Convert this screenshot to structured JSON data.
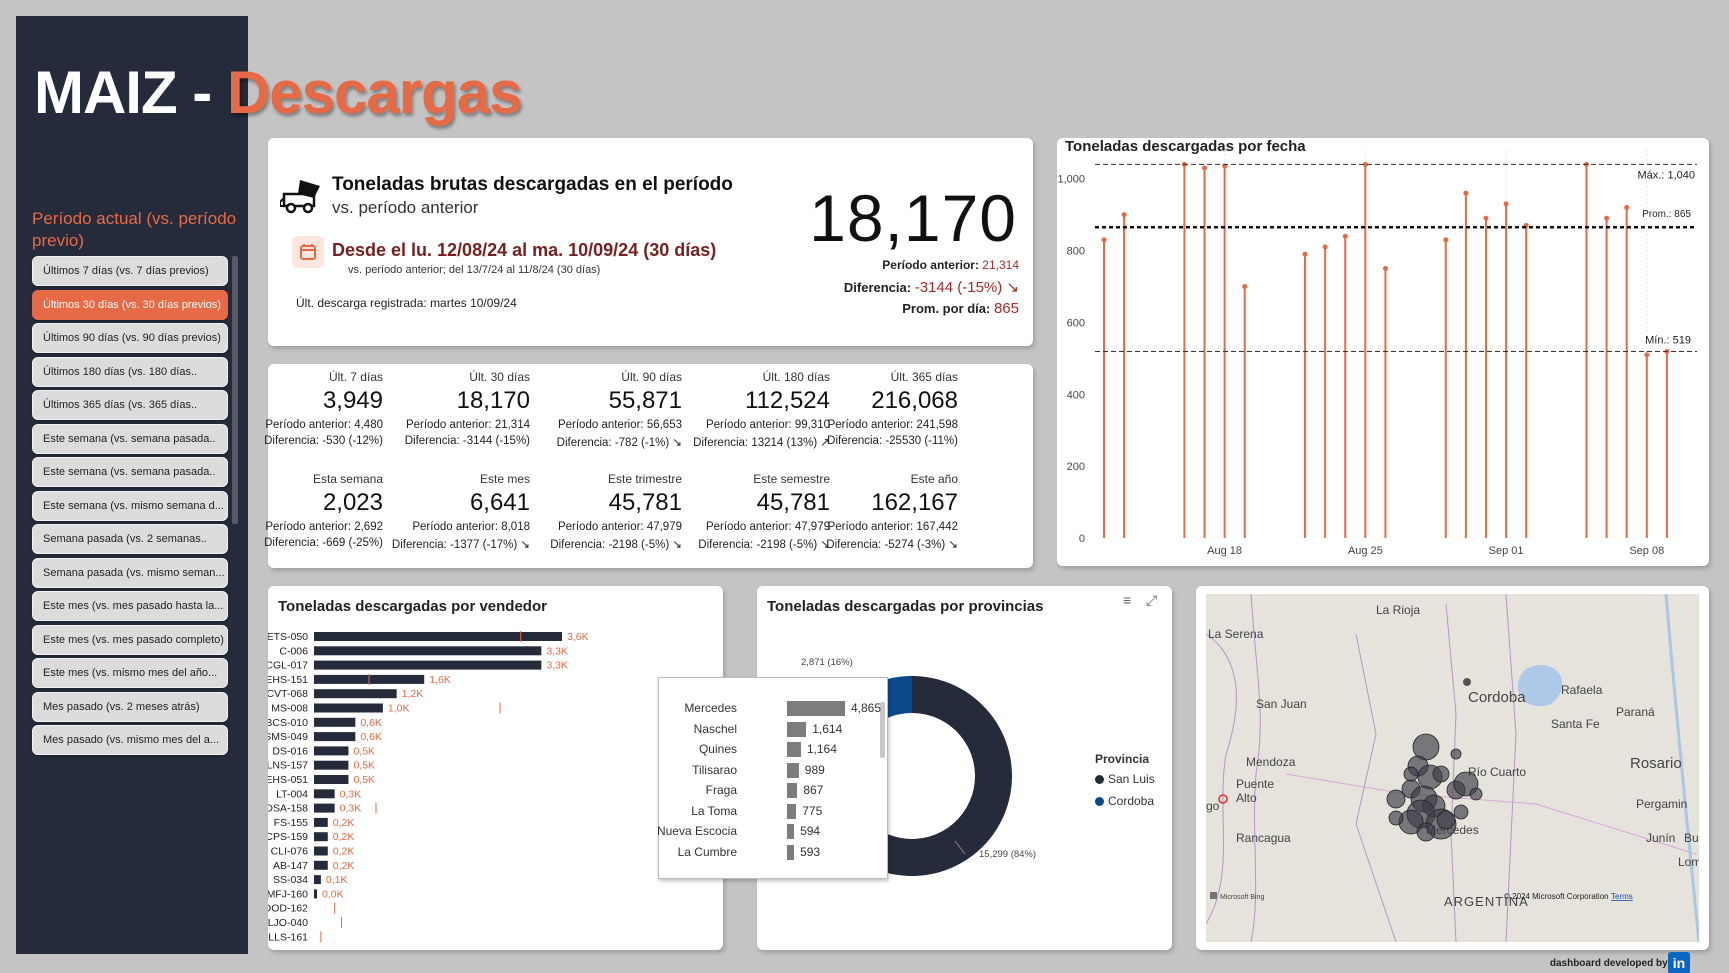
{
  "header": {
    "title_left": "MAIZ - ",
    "title_right": "Descargas"
  },
  "sidebar": {
    "heading": "Período actual (vs. período previo)",
    "items": [
      {
        "label": "Últimos 7 días (vs. 7 días previos)",
        "active": false
      },
      {
        "label": "Últimos 30 días (vs. 30 días previos)",
        "active": true
      },
      {
        "label": "Últimos 90 días (vs. 90 días previos)",
        "active": false
      },
      {
        "label": "Últimos 180 días (vs. 180 días..",
        "active": false
      },
      {
        "label": "Últimos 365 días (vs. 365 días..",
        "active": false
      },
      {
        "label": "Este semana (vs. semana pasada..",
        "active": false
      },
      {
        "label": "Este semana (vs. semana pasada..",
        "active": false
      },
      {
        "label": "Este semana (vs. mismo semana d...",
        "active": false
      },
      {
        "label": "Semana pasada (vs. 2 semanas..",
        "active": false
      },
      {
        "label": "Semana pasada (vs. mismo seman...",
        "active": false
      },
      {
        "label": "Este mes (vs. mes pasado hasta la...",
        "active": false
      },
      {
        "label": "Este mes (vs. mes pasado completo)",
        "active": false
      },
      {
        "label": "Este mes (vs. mismo mes del año...",
        "active": false
      },
      {
        "label": "Mes pasado (vs. 2 meses atrás)",
        "active": false
      },
      {
        "label": "Mes pasado (vs. mismo mes del a...",
        "active": false
      }
    ]
  },
  "main": {
    "heading": "Toneladas brutas descargadas en el período",
    "subheading": "vs. período anterior",
    "desde": "Desde el  lu. 12/08/24 al  ma. 10/09/24 (30 días)",
    "vs_line": "vs. período anterior; del  13/7/24 al  11/8/24 (30 días)",
    "ultima": "Últ. descarga registrada: martes 10/09/24",
    "big_value": "18,170",
    "prev_label": "Período anterior:",
    "prev_value": "21,314",
    "diff_label": "Diferencia:",
    "diff_value": "-3144 (-15%) ↘",
    "prom_label": "Prom. por día:",
    "prom_value": "865"
  },
  "kpis": [
    {
      "label": "Últ. 7 días",
      "value": "3,949",
      "prev": "Período anterior: 4,480",
      "diff": "Diferencia: -530 (-12%)"
    },
    {
      "label": "Últ. 30 días",
      "value": "18,170",
      "prev": "Período anterior: 21,314",
      "diff": "Diferencia: -3144 (-15%)"
    },
    {
      "label": "Últ. 90 días",
      "value": "55,871",
      "prev": "Período anterior: 56,653",
      "diff": "Diferencia: -782 (-1%) ↘"
    },
    {
      "label": "Últ. 180 días",
      "value": "112,524",
      "prev": "Período anterior: 99,310",
      "diff": "Diferencia: 13214 (13%) ↗"
    },
    {
      "label": "Últ. 365 días",
      "value": "216,068",
      "prev": "Período anterior: 241,598",
      "diff": "Diferencia: -25530 (-11%)"
    },
    {
      "label": "Esta semana",
      "value": "2,023",
      "prev": "Período anterior: 2,692",
      "diff": "Diferencia: -669 (-25%)"
    },
    {
      "label": "Este mes",
      "value": "6,641",
      "prev": "Período anterior: 8,018",
      "diff": "Diferencia: -1377 (-17%) ↘"
    },
    {
      "label": "Este trimestre",
      "value": "45,781",
      "prev": "Período anterior: 47,979",
      "diff": "Diferencia: -2198 (-5%) ↘"
    },
    {
      "label": "Este semestre",
      "value": "45,781",
      "prev": "Período anterior: 47,979",
      "diff": "Diferencia: -2198 (-5%) ↘"
    },
    {
      "label": "Este año",
      "value": "162,167",
      "prev": "Período anterior: 167,442",
      "diff": "Diferencia: -5274 (-3%) ↘"
    }
  ],
  "timeline": {
    "title": "Toneladas descargadas por fecha",
    "max_label": "Máx.: 1,040",
    "prom_label": "Prom.: 865",
    "min_label": "Mín.: 519"
  },
  "bars": {
    "title": "Toneladas descargadas por vendedor"
  },
  "donut": {
    "title": "Toneladas descargadas por provincias",
    "legend_title": "Provincia",
    "outer_labels": [
      "2,871 (16%)",
      "15,299 (84%)"
    ]
  },
  "tooltip": {
    "rows": [
      {
        "name": "Mercedes",
        "value": 4865,
        "label": "4,865"
      },
      {
        "name": "Naschel",
        "value": 1614,
        "label": "1,614"
      },
      {
        "name": "Quines",
        "value": 1164,
        "label": "1,164"
      },
      {
        "name": "Tilisarao",
        "value": 989,
        "label": "989"
      },
      {
        "name": "Fraga",
        "value": 867,
        "label": "867"
      },
      {
        "name": "La Toma",
        "value": 775,
        "label": "775"
      },
      {
        "name": "Nueva Escocia",
        "value": 594,
        "label": "594"
      },
      {
        "name": "La Cumbre",
        "value": 593,
        "label": "593"
      }
    ]
  },
  "map": {
    "labels": [
      "La Rioja",
      "La Serena",
      "Cordoba",
      "Rafaela",
      "San Juan",
      "Santa Fe",
      "Paraná",
      "Mendoza",
      "Río Cuarto",
      "Rosario",
      "Puente",
      "Alto",
      "go",
      "Rancagua",
      "Mercedes",
      "Pergamin",
      "Junín",
      "Bu",
      "Loma",
      "ARGENTINA"
    ],
    "copyright": "© 2024 Microsoft Corporation",
    "terms": "Terms",
    "bing": "Microsoft Bing"
  },
  "footer": {
    "credit": "dashboard developed by:",
    "linkedin": "in"
  },
  "colors": {
    "accent": "#e66a45",
    "navy": "#252b3a",
    "cordoba": "#0b4a8a"
  },
  "chart_data": [
    {
      "type": "bar",
      "title": "Toneladas descargadas por fecha",
      "x": [
        "Aug 12",
        "Aug 13",
        "Aug 14",
        "Aug 15",
        "Aug 16",
        "Aug 17",
        "Aug 18",
        "Aug 19",
        "Aug 20",
        "Aug 21",
        "Aug 22",
        "Aug 23",
        "Aug 24",
        "Aug 25",
        "Aug 26",
        "Aug 27",
        "Aug 28",
        "Aug 29",
        "Aug 30",
        "Aug 31",
        "Sep 01",
        "Sep 02",
        "Sep 03",
        "Sep 04",
        "Sep 05",
        "Sep 06",
        "Sep 07",
        "Sep 08",
        "Sep 09",
        "Sep 10"
      ],
      "values": [
        830,
        900,
        0,
        0,
        1040,
        1030,
        1035,
        700,
        0,
        0,
        790,
        810,
        840,
        1040,
        750,
        0,
        0,
        830,
        960,
        890,
        930,
        870,
        0,
        0,
        1040,
        890,
        920,
        510,
        519,
        0
      ],
      "x_ticks": [
        "Aug 18",
        "Aug 25",
        "Sep 01",
        "Sep 08"
      ],
      "y_ticks": [
        0,
        200,
        400,
        600,
        800,
        "1,000"
      ],
      "ylim": [
        0,
        1080
      ],
      "reference_lines": {
        "max": 1040,
        "avg": 865,
        "min": 519
      }
    },
    {
      "type": "bar",
      "orientation": "horizontal",
      "title": "Toneladas descargadas por vendedor",
      "categories": [
        "ETS-050",
        "C-006",
        "ACGL-017",
        "AGEHS-151",
        "ACVT-068",
        "MS-008",
        "RBCS-010",
        "SMS-049",
        "DS-016",
        "LNS-157",
        "KJEHS-051",
        "LT-004",
        "CDSA-158",
        "FS-155",
        "CPS-159",
        "CLI-076",
        "AB-147",
        "SS-034",
        "MFJ-160",
        "DOD-162",
        "LJO-040",
        "LLS-161"
      ],
      "values": [
        3.6,
        3.3,
        3.3,
        1.6,
        1.2,
        1.0,
        0.6,
        0.6,
        0.5,
        0.5,
        0.5,
        0.3,
        0.3,
        0.2,
        0.2,
        0.2,
        0.2,
        0.1,
        0.0,
        null,
        null,
        null
      ],
      "value_labels": [
        "3,6K",
        "3,3K",
        "3,3K",
        "1,6K",
        "1,2K",
        "1,0K",
        "0,6K",
        "0,6K",
        "0,5K",
        "0,5K",
        "0,5K",
        "0,3K",
        "0,3K",
        "0,2K",
        "0,2K",
        "0,2K",
        "0,2K",
        "0,1K",
        "0,0K",
        "",
        "",
        ""
      ],
      "targets": [
        3.0,
        null,
        null,
        0.8,
        null,
        2.7,
        null,
        null,
        null,
        null,
        null,
        null,
        0.9,
        null,
        null,
        null,
        null,
        null,
        null,
        0.3,
        0.4,
        0.1
      ],
      "unit": "K"
    },
    {
      "type": "pie",
      "title": "Toneladas descargadas por provincias",
      "categories": [
        "San Luis",
        "Cordoba"
      ],
      "values": [
        15299,
        2871
      ],
      "labels": [
        "15,299 (84%)",
        "2,871 (16%)"
      ],
      "colors": [
        "#252b3a",
        "#0b4a8a"
      ],
      "legend": "right"
    }
  ]
}
